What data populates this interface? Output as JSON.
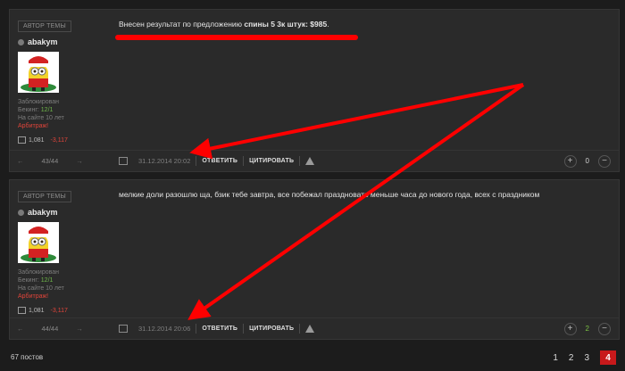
{
  "posts": [
    {
      "badge": "АВТОР ТЕМЫ",
      "username": "abakym",
      "status": "Заблокирован",
      "bek_label": "Бекинг:",
      "bek_value": "12/1",
      "on_site": "На сайте 10 лет",
      "arbitrage": "Арбитраж!",
      "posts_count": "1,081",
      "rating": "-3,117",
      "content_plain": "Внесен результат по предложению ",
      "content_bold": "спины 5 3к штук: $985",
      "content_end": ".",
      "position": "43/44",
      "date": "31.12.2014 20:02",
      "reply": "ОТВЕТИТЬ",
      "quote": "ЦИТИРОВАТЬ",
      "votes": "0"
    },
    {
      "badge": "АВТОР ТЕМЫ",
      "username": "abakym",
      "status": "Заблокирован",
      "bek_label": "Бекинг:",
      "bek_value": "12/1",
      "on_site": "На сайте 10 лет",
      "arbitrage": "Арбитраж!",
      "posts_count": "1,081",
      "rating": "-3,117",
      "content": "мелкие доли разошлю ща, бзик тебе завтра, все побежал праздновать меньше часа до нового года, всех с праздником",
      "position": "44/44",
      "date": "31.12.2014 20:06",
      "reply": "ОТВЕТИТЬ",
      "quote": "ЦИТИРОВАТЬ",
      "votes": "2"
    }
  ],
  "footer": {
    "total_posts": "67 постов",
    "pages": [
      "1",
      "2",
      "3",
      "4"
    ],
    "current_page": "4"
  },
  "colors": {
    "accent": "#c8191b",
    "annotation": "#ff0000",
    "positive": "#7ac043",
    "negative": "#e0443a"
  }
}
